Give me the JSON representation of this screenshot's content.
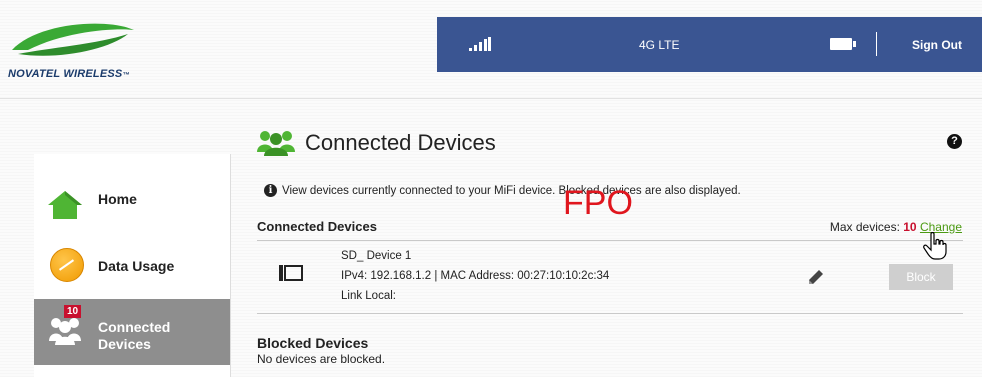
{
  "brand": {
    "logo_text": "NOVATEL WIRELESS",
    "logo_tm": "™"
  },
  "status_bar": {
    "network": "4G LTE",
    "sign_out": "Sign Out"
  },
  "sidebar": {
    "items": [
      {
        "label": "Home"
      },
      {
        "label": "Data Usage"
      },
      {
        "label_line1": "Connected",
        "label_line2": "Devices",
        "badge": "10"
      }
    ]
  },
  "page": {
    "title": "Connected Devices",
    "help_icon": "?",
    "info_icon": "i",
    "info_text": "View devices currently connected to your MiFi device. Blocked devices are also displayed.",
    "fpo": "FPO"
  },
  "connected": {
    "section_title": "Connected Devices",
    "max_label": "Max devices:",
    "max_value": "10",
    "change_label": "Change",
    "devices": [
      {
        "name": "SD_ Device 1",
        "address": "IPv4: 192.168.1.2 | MAC Address: 00:27:10:10:2c:34",
        "link": "Link Local:",
        "action": "Block"
      }
    ]
  },
  "blocked": {
    "section_title": "Blocked Devices",
    "empty_text": "No devices are blocked."
  },
  "colors": {
    "topbar": "#3a5592",
    "accent_green": "#4b9a12",
    "alert_red": "#c8102e",
    "active_nav": "#8e8e8e"
  }
}
